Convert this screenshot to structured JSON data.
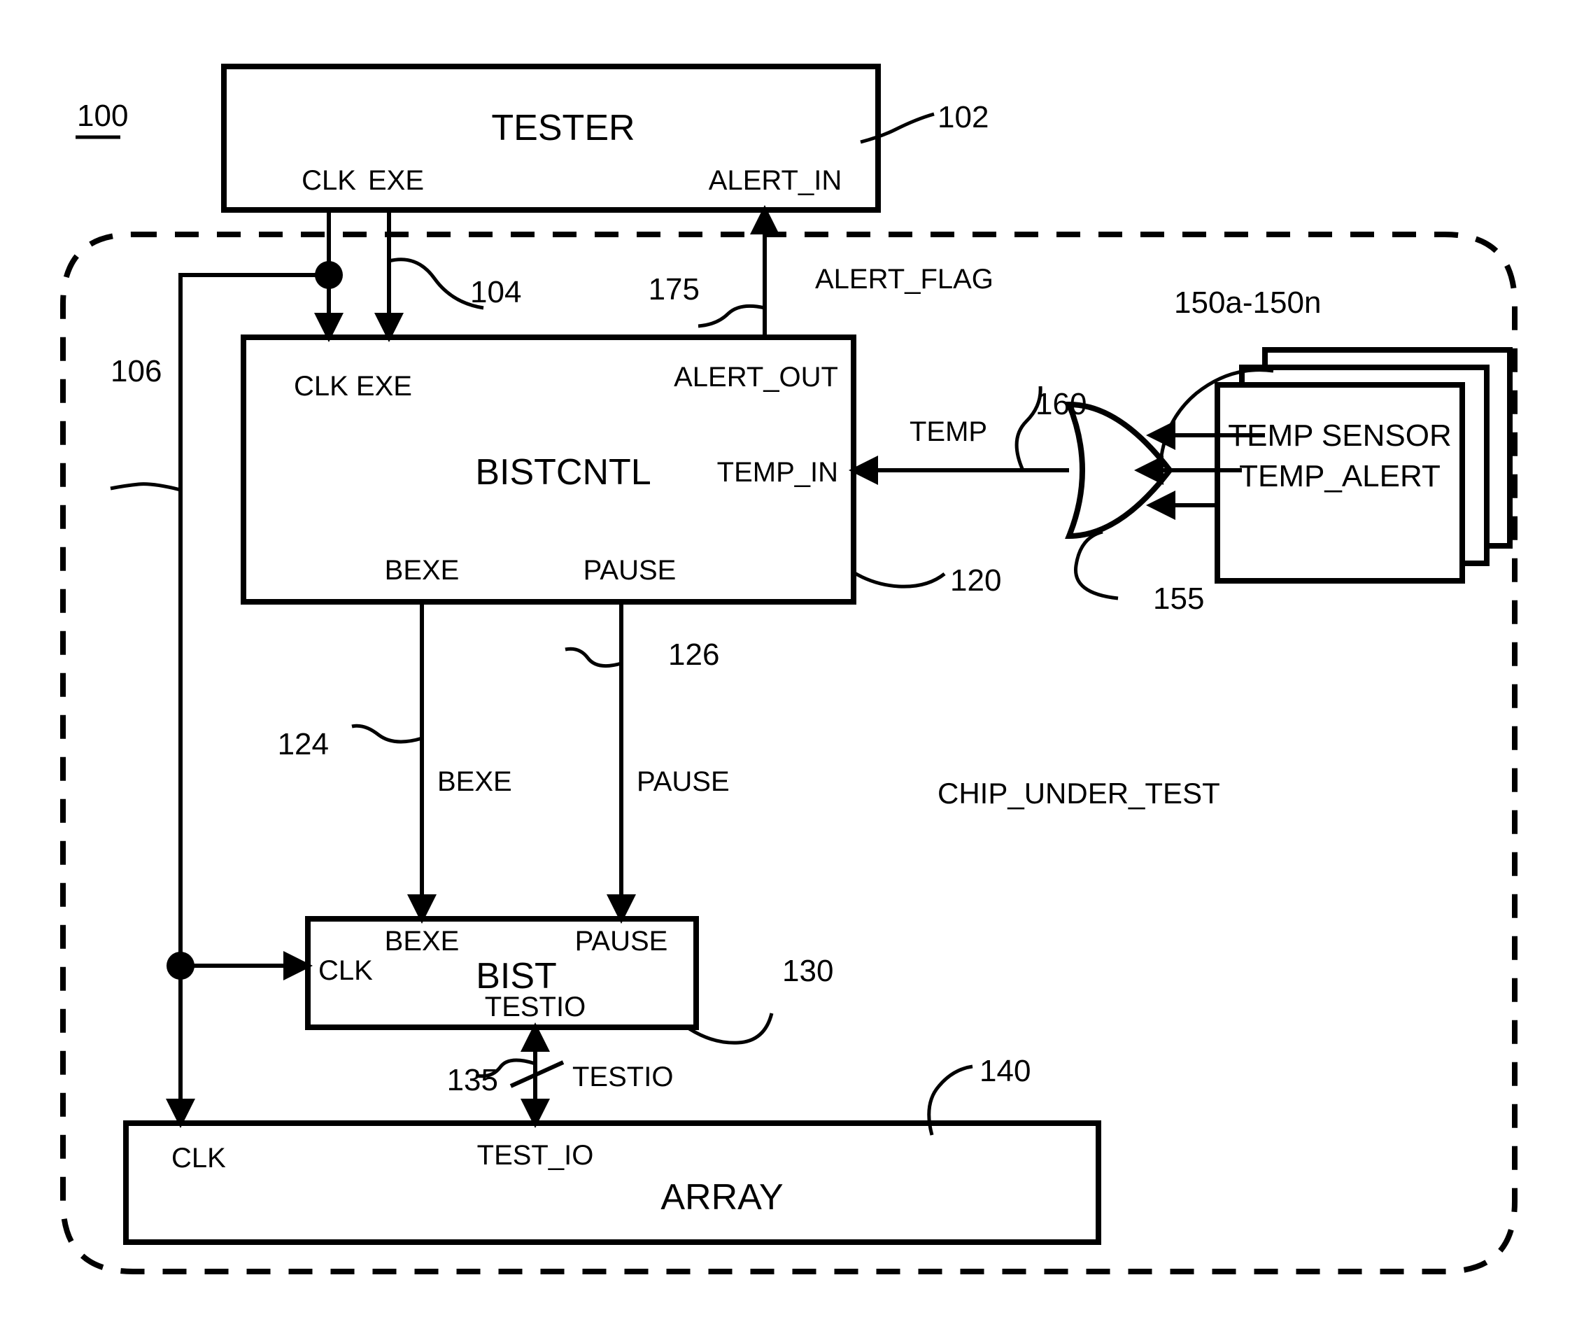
{
  "figure": {
    "number": "100",
    "region_label": "CHIP_UNDER_TEST"
  },
  "blocks": {
    "tester": {
      "title": "TESTER",
      "ref": "102",
      "ports": {
        "clk": "CLK",
        "exe": "EXE",
        "alert_in": "ALERT_IN"
      }
    },
    "bistcntl": {
      "title": "BISTCNTL",
      "ref": "120",
      "ports": {
        "clk_exe": "CLK EXE",
        "alert_out": "ALERT_OUT",
        "temp_in": "TEMP_IN",
        "bexe": "BEXE",
        "pause": "PAUSE"
      }
    },
    "bist": {
      "title": "BIST",
      "ref": "130",
      "ports": {
        "clk": "CLK",
        "bexe": "BEXE",
        "pause": "PAUSE",
        "testio": "TESTIO"
      }
    },
    "array": {
      "title": "ARRAY",
      "ref": "140",
      "ports": {
        "clk": "CLK",
        "test_io": "TEST_IO"
      }
    },
    "or_gate": {
      "ref": "155"
    },
    "temp_sensors": {
      "ref": "150a-150n",
      "line1": "TEMP SENSOR",
      "line2": "TEMP_ALERT"
    }
  },
  "signals": {
    "exe_bus": {
      "ref": "104"
    },
    "clk_bus": {
      "ref": "106"
    },
    "alert_flag": {
      "name": "ALERT_FLAG",
      "ref": "175"
    },
    "temp": {
      "name": "TEMP",
      "ref": "160"
    },
    "bexe": {
      "name": "BEXE",
      "ref": "124"
    },
    "pause": {
      "name": "PAUSE",
      "ref": "126"
    },
    "testio": {
      "name": "TESTIO",
      "ref": "135"
    }
  }
}
